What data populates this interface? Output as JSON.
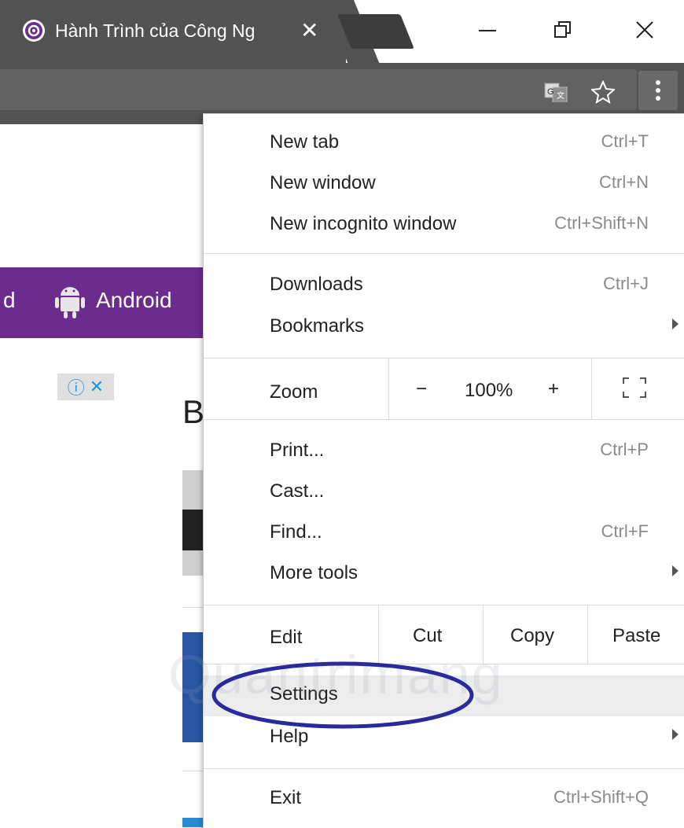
{
  "tab": {
    "title": "Hành Trình của Công Ng",
    "close": "✕"
  },
  "window_controls": {
    "minimize": "—",
    "maximize": "⧉",
    "close": "✕"
  },
  "toolbar": {
    "translate_icon": "translate-icon",
    "star_icon": "bookmark-star-icon",
    "menu_icon": "more-vert-icon"
  },
  "page": {
    "nav_partial": "d",
    "nav_android": "Android",
    "heading_partial": "B",
    "adchoices": {
      "info": "ⓘ",
      "close": "✕"
    },
    "nav_color": "#6b2c8e"
  },
  "menu": {
    "group1": [
      {
        "label": "New tab",
        "shortcut": "Ctrl+T"
      },
      {
        "label": "New window",
        "shortcut": "Ctrl+N"
      },
      {
        "label": "New incognito window",
        "shortcut": "Ctrl+Shift+N"
      }
    ],
    "group2": [
      {
        "label": "Downloads",
        "shortcut": "Ctrl+J"
      },
      {
        "label": "Bookmarks",
        "shortcut": ""
      }
    ],
    "zoom": {
      "label": "Zoom",
      "minus": "−",
      "value": "100%",
      "plus": "+"
    },
    "group3": [
      {
        "label": "Print...",
        "shortcut": "Ctrl+P"
      },
      {
        "label": "Cast...",
        "shortcut": ""
      },
      {
        "label": "Find...",
        "shortcut": "Ctrl+F"
      },
      {
        "label": "More tools",
        "shortcut": ""
      }
    ],
    "edit": {
      "label": "Edit",
      "cut": "Cut",
      "copy": "Copy",
      "paste": "Paste"
    },
    "group4": [
      {
        "label": "Settings",
        "shortcut": ""
      },
      {
        "label": "Help",
        "shortcut": ""
      }
    ],
    "exit": {
      "label": "Exit",
      "shortcut": "Ctrl+Shift+Q"
    }
  },
  "annotation": {
    "highlight_color": "#2b2a9c"
  },
  "watermark": "Quantrimang"
}
